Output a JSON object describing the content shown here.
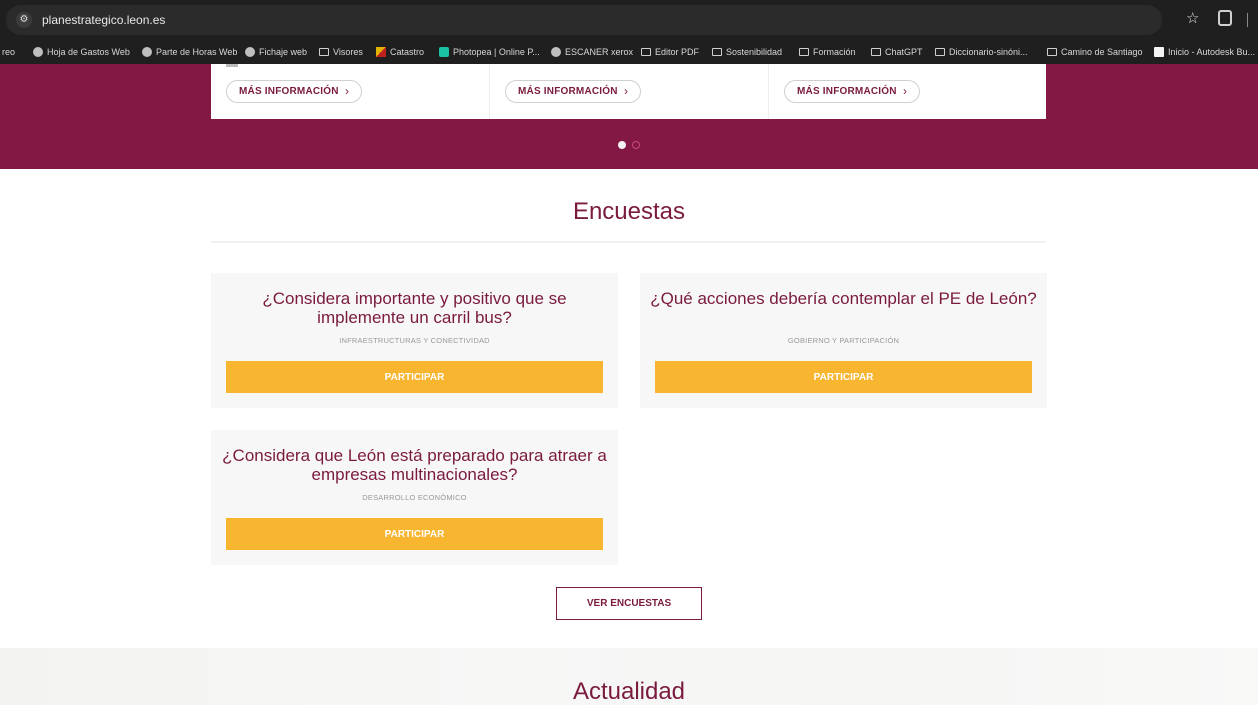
{
  "browser": {
    "url": "planestrategico.leon.es",
    "bookmarks": [
      {
        "label": "reo",
        "icon": "none"
      },
      {
        "label": "Hoja de Gastos Web",
        "icon": "globe-icon"
      },
      {
        "label": "Parte de Horas Web",
        "icon": "globe-icon"
      },
      {
        "label": "Fichaje web",
        "icon": "globe-icon"
      },
      {
        "label": "Visores",
        "icon": "folder-icon"
      },
      {
        "label": "Catastro",
        "icon": "catastro-icon"
      },
      {
        "label": "Photopea | Online P...",
        "icon": "photopea-icon"
      },
      {
        "label": "ESCANER xerox",
        "icon": "globe-icon"
      },
      {
        "label": "Editor PDF",
        "icon": "folder-icon"
      },
      {
        "label": "Sostenibilidad",
        "icon": "folder-icon"
      },
      {
        "label": "Formación",
        "icon": "folder-icon"
      },
      {
        "label": "ChatGPT",
        "icon": "folder-icon"
      },
      {
        "label": "Diccionario-sinóni...",
        "icon": "folder-icon"
      },
      {
        "label": "Camino de Santiago",
        "icon": "folder-icon"
      },
      {
        "label": "Inicio - Autodesk Bu...",
        "icon": "autodesk-icon"
      }
    ]
  },
  "hero": {
    "cards": [
      {
        "button": "MÁS INFORMACIÓN",
        "chevron": "›"
      },
      {
        "button": "MÁS INFORMACIÓN",
        "chevron": "›"
      },
      {
        "button": "MÁS INFORMACIÓN",
        "chevron": "›"
      }
    ],
    "slides": 2,
    "active_slide": 1
  },
  "encuestas": {
    "title": "Encuestas",
    "items": [
      {
        "question": "¿Considera importante y positivo que se implemente un carril bus?",
        "category": "INFRAESTRUCTURAS Y CONECTIVIDAD",
        "button": "PARTICIPAR"
      },
      {
        "question": "¿Qué acciones debería contemplar el PE de León?",
        "category": "GOBIERNO Y PARTICIPACIÓN",
        "button": "PARTICIPAR"
      },
      {
        "question": "¿Considera que León está preparado para atraer a empresas multinacionales?",
        "category": "DESARROLLO ECONÓMICO",
        "button": "PARTICIPAR"
      }
    ],
    "more_button": "VER ENCUESTAS"
  },
  "actualidad": {
    "title": "Actualidad"
  },
  "colors": {
    "brand": "#841844",
    "accent": "#f8b530",
    "text_brand": "#7a1a3e"
  }
}
